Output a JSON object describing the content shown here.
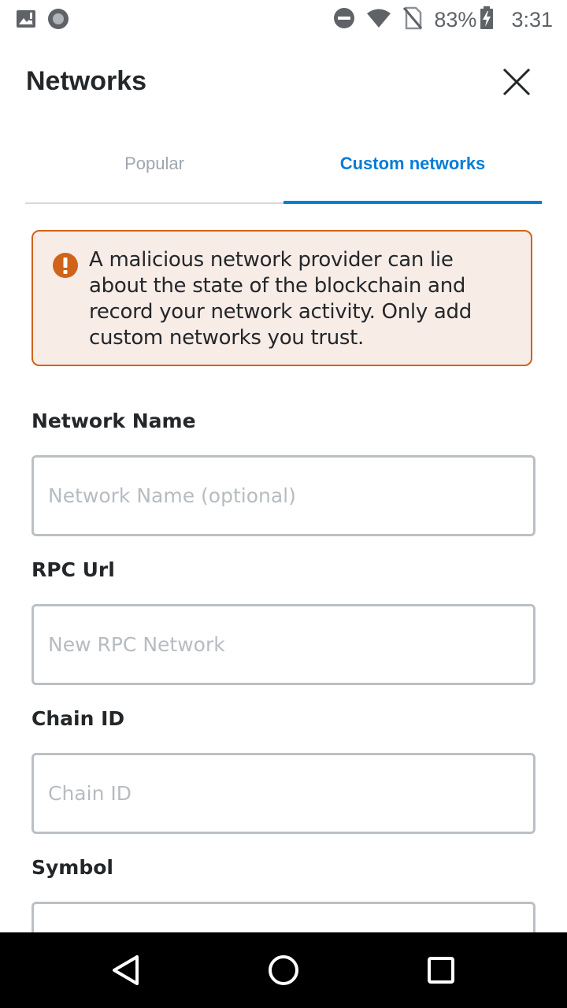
{
  "status_bar": {
    "battery": "83%",
    "time": "3:31",
    "icons": [
      "image-notification-icon",
      "record-icon",
      "do-not-disturb-icon",
      "wifi-icon",
      "no-sim-icon",
      "battery-charging-icon"
    ]
  },
  "header": {
    "title": "Networks",
    "close_icon": "close-icon"
  },
  "tabs": [
    {
      "label": "Popular",
      "active": false
    },
    {
      "label": "Custom networks",
      "active": true
    }
  ],
  "warning": {
    "icon": "warning-icon",
    "text": "A malicious network provider can lie about the state of the blockchain and record your network activity. Only add custom networks you trust."
  },
  "form": {
    "network_name": {
      "label": "Network Name",
      "placeholder": "Network Name (optional)",
      "value": ""
    },
    "rpc_url": {
      "label": "RPC Url",
      "placeholder": "New RPC Network",
      "value": ""
    },
    "chain_id": {
      "label": "Chain ID",
      "placeholder": "Chain ID",
      "value": ""
    },
    "symbol": {
      "label": "Symbol",
      "placeholder": "",
      "value": ""
    }
  },
  "nav_bar": {
    "icons": [
      "back-triangle-icon",
      "home-circle-icon",
      "recents-square-icon"
    ]
  },
  "colors": {
    "accent": "#037dd6",
    "warning_border": "#d0631a",
    "warning_bg": "#f8ece7",
    "text": "#24272a"
  }
}
